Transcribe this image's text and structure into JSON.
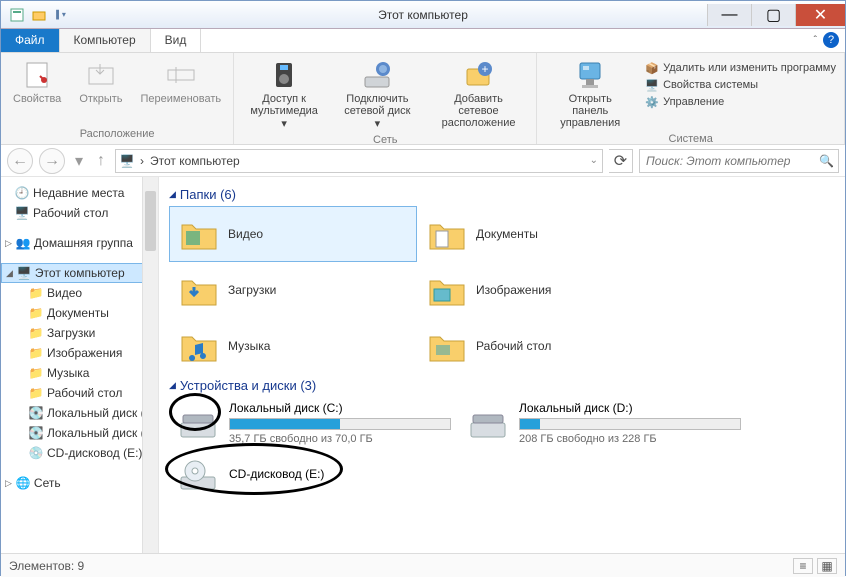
{
  "title": "Этот компьютер",
  "tabs": {
    "file": "Файл",
    "computer": "Компьютер",
    "view": "Вид"
  },
  "ribbon": {
    "group1": {
      "label": "Расположение",
      "props": "Свойства",
      "open": "Открыть",
      "rename": "Переименовать"
    },
    "group2": {
      "label": "Сеть",
      "media1": "Доступ к",
      "media2": "мультимедиа",
      "map1": "Подключить",
      "map2": "сетевой диск",
      "addnet1": "Добавить сетевое",
      "addnet2": "расположение"
    },
    "group3": {
      "label": "Система",
      "cpl1": "Открыть панель",
      "cpl2": "управления",
      "uninstall": "Удалить или изменить программу",
      "sysprops": "Свойства системы",
      "manage": "Управление"
    }
  },
  "breadcrumb": "Этот компьютер",
  "search": {
    "placeholder": "Поиск: Этот компьютер"
  },
  "sidebar": {
    "recent": "Недавние места",
    "desktop": "Рабочий стол",
    "homegroup": "Домашняя группа",
    "thispc": "Этот компьютер",
    "videos": "Видео",
    "documents": "Документы",
    "downloads": "Загрузки",
    "pictures": "Изображения",
    "music": "Музыка",
    "desk2": "Рабочий стол",
    "localc": "Локальный диск (C:)",
    "locald": "Локальный диск (D:)",
    "cddrive": "CD-дисковод (E:)",
    "network": "Сеть"
  },
  "sections": {
    "folders": "Папки (6)",
    "drives": "Устройства и диски (3)"
  },
  "folders": {
    "videos": "Видео",
    "documents": "Документы",
    "downloads": "Загрузки",
    "pictures": "Изображения",
    "music": "Музыка",
    "desktop": "Рабочий стол"
  },
  "drives": {
    "c": {
      "name": "Локальный диск (C:)",
      "sub": "35,7 ГБ свободно из 70,0 ГБ",
      "fill": 50
    },
    "d": {
      "name": "Локальный диск (D:)",
      "sub": "208 ГБ свободно из 228 ГБ",
      "fill": 9
    },
    "e": {
      "name": "CD-дисковод (E:)"
    }
  },
  "status": "Элементов: 9"
}
